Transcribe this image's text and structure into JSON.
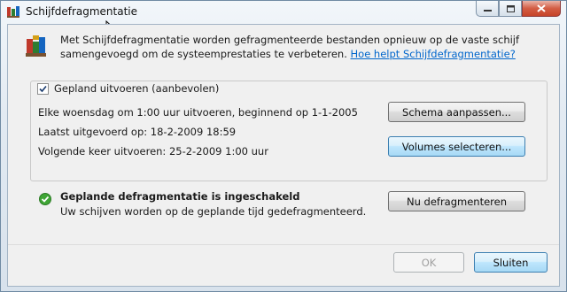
{
  "window": {
    "title": "Schijfdefragmentatie",
    "controls": [
      "minimize-icon",
      "maximize-icon",
      "close-icon"
    ]
  },
  "intro": {
    "text": "Met Schijfdefragmentatie worden gefragmenteerde bestanden opnieuw op de vaste schijf samengevoegd om de systeemprestaties te verbeteren. ",
    "link": "Hoe helpt Schijfdefragmentatie?"
  },
  "schedule": {
    "checkbox_label": "Gepland uitvoeren (aanbevolen)",
    "checked": true,
    "frequency": "Elke woensdag om 1:00 uur uitvoeren, beginnend op 1-1-2005",
    "last_run": "Laatst uitgevoerd op: 18-2-2009 18:59",
    "next_run": "Volgende keer uitvoeren: 25-2-2009 1:00 uur",
    "modify_button": "Schema aanpassen...",
    "volumes_button": "Volumes selecteren..."
  },
  "status": {
    "title": "Geplande defragmentatie is ingeschakeld",
    "subtitle": "Uw schijven worden op de geplande tijd gedefragmenteerd.",
    "defrag_now_button": "Nu defragmenteren"
  },
  "footer": {
    "ok_button": "OK",
    "close_button": "Sluiten"
  },
  "colors": {
    "link": "#0066cc",
    "status_ok": "#3fa535",
    "focus_button": "#bee6fd"
  }
}
